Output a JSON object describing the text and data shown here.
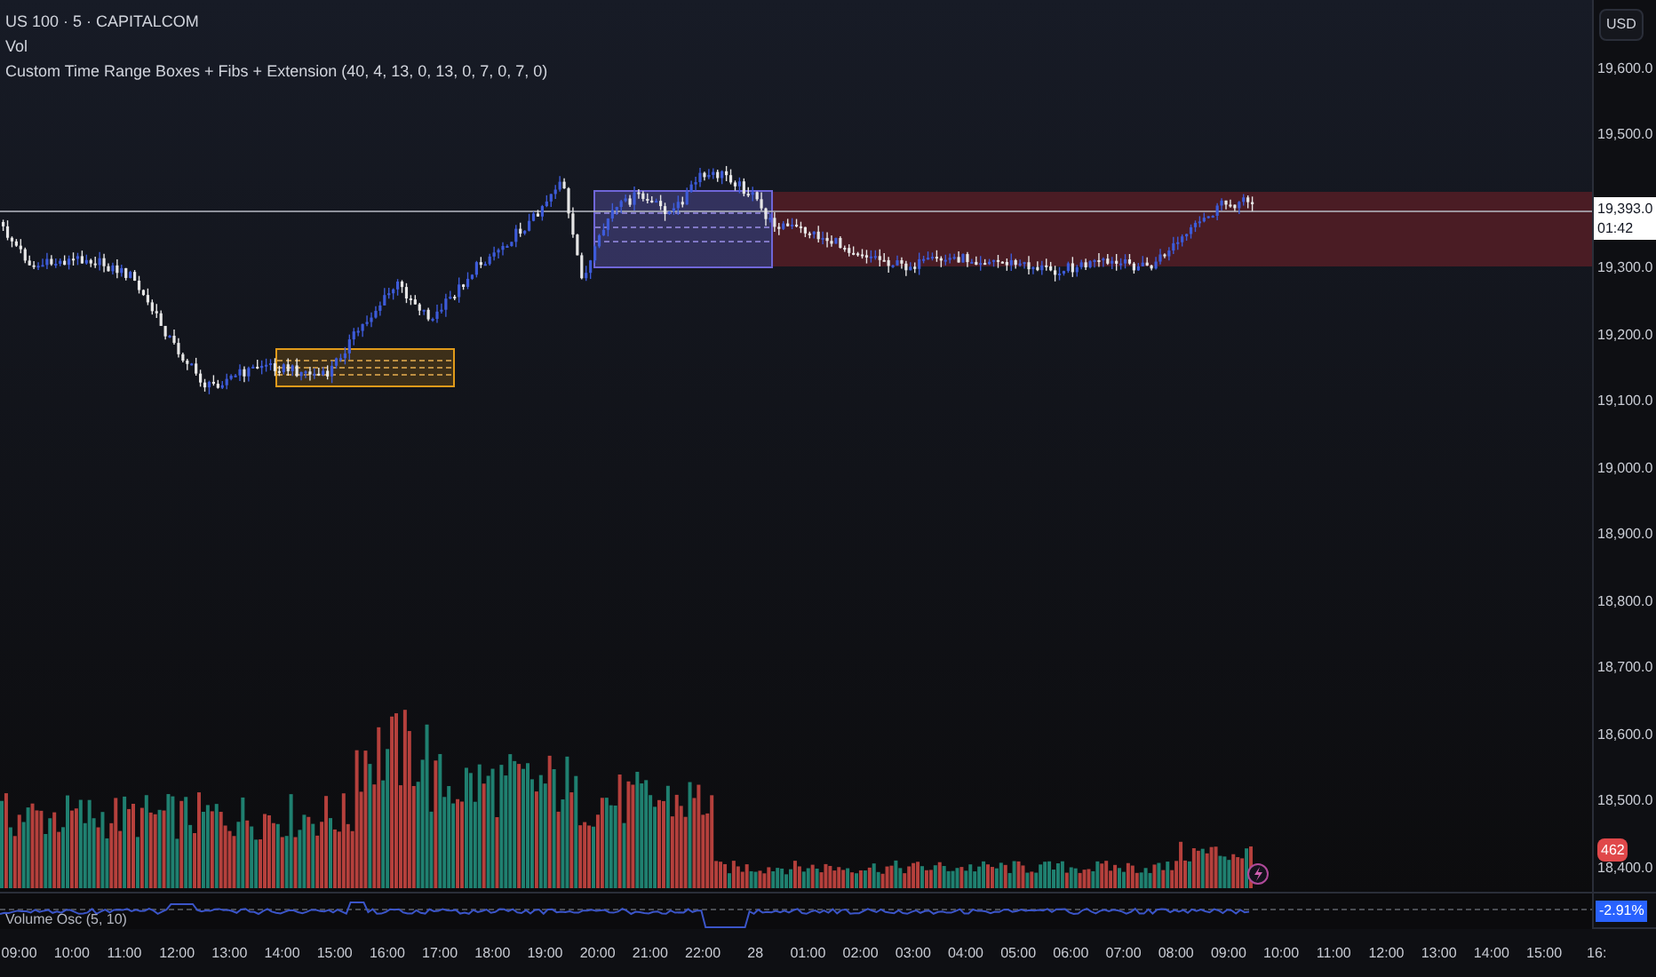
{
  "legend": {
    "symbol": "US 100 · 5 · CAPITALCOM",
    "volume": "Vol",
    "indicator": "Custom Time Range Boxes + Fibs + Extension (40, 4, 13, 0, 13, 0, 7, 0, 7, 0)"
  },
  "currency_button": "USD",
  "price_axis": {
    "labels": [
      "19,600.0",
      "19,500.0",
      "19,300.0",
      "19,200.0",
      "19,100.0",
      "19,000.0",
      "18,900.0",
      "18,800.0",
      "18,700.0",
      "18,600.0",
      "18,500.0",
      "18,400.0"
    ],
    "last_price": "19,393.0",
    "countdown": "01:42",
    "volume_badge": "462"
  },
  "oscillator": {
    "label": "Volume Osc (5, 10)",
    "value": "-2.91%"
  },
  "time_axis": {
    "labels": [
      "09:00",
      "10:00",
      "11:00",
      "12:00",
      "13:00",
      "14:00",
      "15:00",
      "16:00",
      "17:00",
      "18:00",
      "19:00",
      "20:00",
      "21:00",
      "22:00",
      "28",
      "01:00",
      "02:00",
      "03:00",
      "04:00",
      "05:00",
      "06:00",
      "07:00",
      "08:00",
      "09:00",
      "10:00",
      "11:00",
      "12:00",
      "13:00",
      "14:00",
      "15:00",
      "16:"
    ]
  }
}
